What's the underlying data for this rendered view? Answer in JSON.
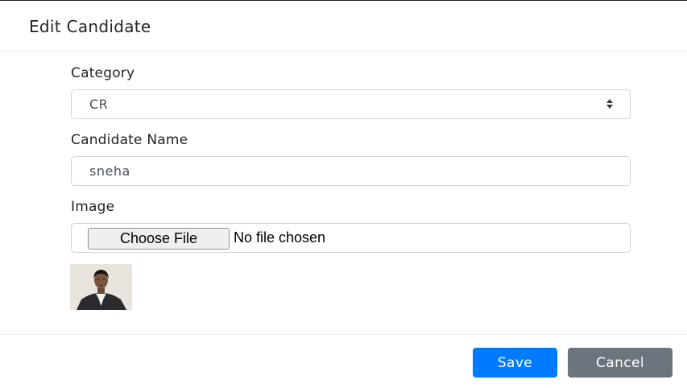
{
  "modal": {
    "title": "Edit Candidate"
  },
  "form": {
    "category": {
      "label": "Category",
      "selected": "CR"
    },
    "candidate_name": {
      "label": "Candidate Name",
      "value": "sneha"
    },
    "image": {
      "label": "Image",
      "button_label": "Choose File",
      "status": "No file chosen"
    }
  },
  "footer": {
    "save_label": "Save",
    "cancel_label": "Cancel"
  },
  "colors": {
    "primary": "#007bff",
    "secondary": "#6c757d",
    "border": "#ced4da"
  }
}
